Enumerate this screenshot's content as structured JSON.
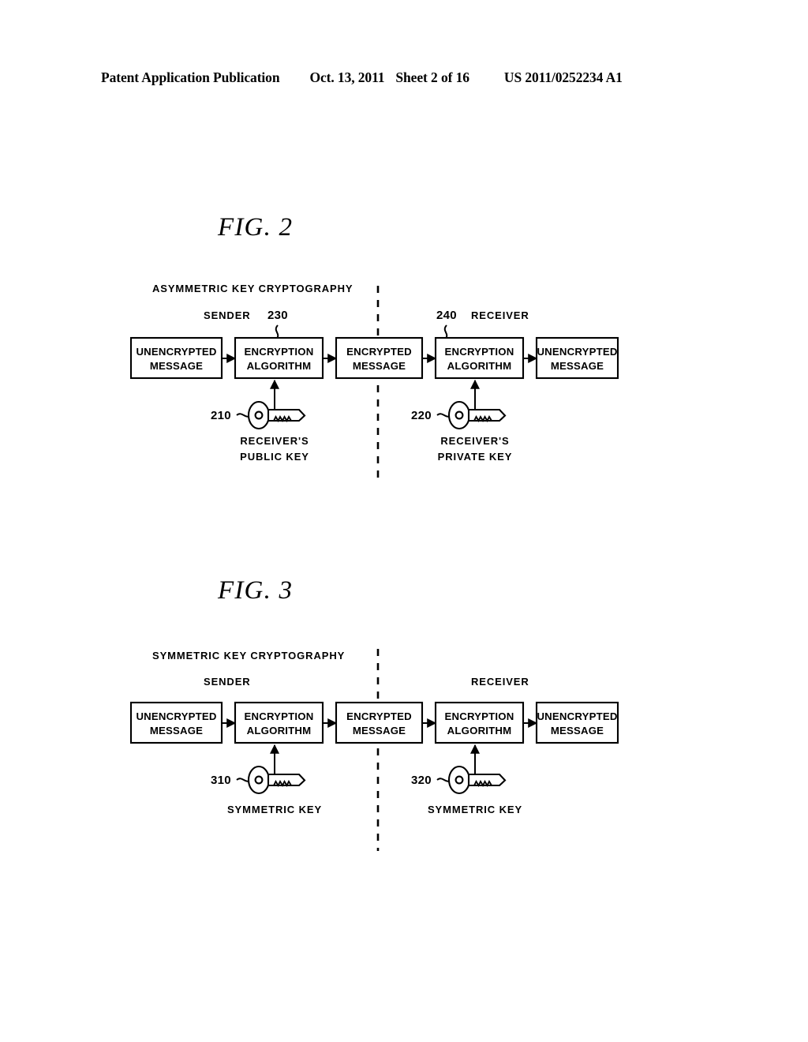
{
  "header": {
    "publication": "Patent Application Publication",
    "date": "Oct. 13, 2011",
    "sheet": "Sheet 2 of 16",
    "patent_number": "US 2011/0252234 A1"
  },
  "figures": [
    {
      "id": "figure-2",
      "title": "FIG. 2",
      "scheme_label": "ASYMMETRIC KEY CRYPTOGRAPHY",
      "sender_label": "SENDER",
      "receiver_label": "RECEIVER",
      "sender_ref": "230",
      "receiver_ref": "240",
      "boxes": [
        {
          "line1": "UNENCRYPTED",
          "line2": "MESSAGE"
        },
        {
          "line1": "ENCRYPTION",
          "line2": "ALGORITHM"
        },
        {
          "line1": "ENCRYPTED",
          "line2": "MESSAGE"
        },
        {
          "line1": "ENCRYPTION",
          "line2": "ALGORITHM"
        },
        {
          "line1": "UNENCRYPTED",
          "line2": "MESSAGE"
        }
      ],
      "keys": [
        {
          "ref": "210",
          "line1": "RECEIVER'S",
          "line2": "PUBLIC KEY"
        },
        {
          "ref": "220",
          "line1": "RECEIVER'S",
          "line2": "PRIVATE KEY"
        }
      ]
    },
    {
      "id": "figure-3",
      "title": "FIG. 3",
      "scheme_label": "SYMMETRIC KEY CRYPTOGRAPHY",
      "sender_label": "SENDER",
      "receiver_label": "RECEIVER",
      "sender_ref": "",
      "receiver_ref": "",
      "boxes": [
        {
          "line1": "UNENCRYPTED",
          "line2": "MESSAGE"
        },
        {
          "line1": "ENCRYPTION",
          "line2": "ALGORITHM"
        },
        {
          "line1": "ENCRYPTED",
          "line2": "MESSAGE"
        },
        {
          "line1": "ENCRYPTION",
          "line2": "ALGORITHM"
        },
        {
          "line1": "UNENCRYPTED",
          "line2": "MESSAGE"
        }
      ],
      "keys": [
        {
          "ref": "310",
          "line1": "SYMMETRIC KEY",
          "line2": ""
        },
        {
          "ref": "320",
          "line1": "SYMMETRIC KEY",
          "line2": ""
        }
      ]
    }
  ],
  "colors": {
    "ink": "#000000",
    "paper": "#ffffff"
  }
}
